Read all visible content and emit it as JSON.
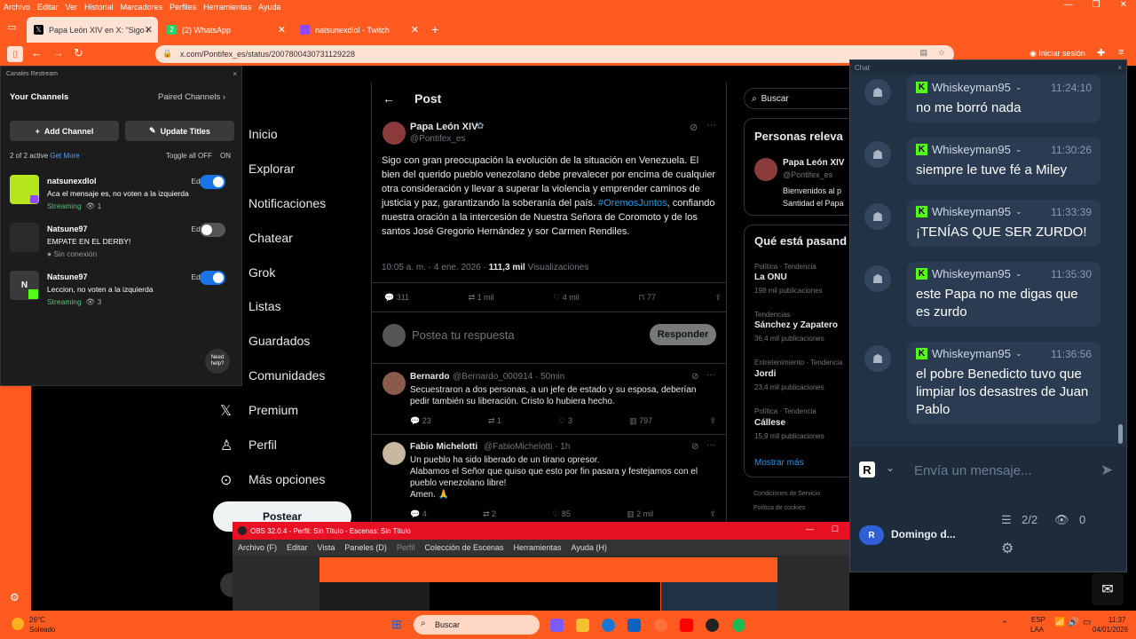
{
  "menubar": {
    "items": [
      "Archivo",
      "Editar",
      "Ver",
      "Historial",
      "Marcadores",
      "Perfiles",
      "Herramientas",
      "Ayuda"
    ]
  },
  "tabs": [
    {
      "label": "Papa León XIV en X: \"Sigo con gran",
      "icon": "x-logo",
      "active": true
    },
    {
      "label": "(2) WhatsApp",
      "badge": "2",
      "icon": "whatsapp",
      "active": false
    },
    {
      "label": "natsunexdlol - Twitch",
      "icon": "twitch",
      "active": false
    }
  ],
  "toolbar": {
    "url": "x.com/Pontifex_es/status/2007800430731129228",
    "signin": "Iniciar sesión"
  },
  "restream": {
    "title": "Canales Restream",
    "your_channels": "Your Channels",
    "paired_channels": "Paired Channels",
    "add_channel": "Add Channel",
    "update_titles": "Update Titles",
    "active_count": "2 of 2 active",
    "get_more": "Get More",
    "toggle_all": "Toggle all OFF",
    "on": "ON",
    "edit": "Edit",
    "need_help": "Need help?",
    "channels": [
      {
        "name": "natsunexdlol",
        "title": "Aca el mensaje es, no voten a la izquierda",
        "status": "Streaming",
        "viewers": "1",
        "on": true
      },
      {
        "name": "Natsune97",
        "title": "EMPATE EN EL DERBY!",
        "status": "Sin conexión",
        "viewers": "",
        "on": false
      },
      {
        "name": "Natsune97",
        "title": "Leccion, no voten a la izquierda",
        "status": "Streaming",
        "viewers": "3",
        "on": true
      }
    ]
  },
  "xnav": {
    "items": [
      "Inicio",
      "Explorar",
      "Notificaciones",
      "Chatear",
      "Grok",
      "Listas",
      "Guardados",
      "Comunidades",
      "Premium",
      "Perfil",
      "Más opciones"
    ],
    "post_button": "Postear"
  },
  "post": {
    "header": "Post",
    "author": "Papa León XIV",
    "handle": "@Pontifex_es",
    "text1": "Sigo con gran preocupación la evolución de la situación en Venezuela. El bien del querido pueblo venezolano debe prevalecer por encima de cualquier otra consideración y llevar a superar la violencia y emprender caminos de justicia y paz, garantizando la soberanía del país.",
    "hashtag": "#OremosJuntos",
    "text2": ", confiando nuestra oración a la intercesión de Nuestra Señora de Coromoto y de los santos José Gregorio Hernández y sor Carmen Rendiles.",
    "time": "10:05 a. m. · 4 ene. 2026 ·",
    "views": "111,3 mil",
    "views_label": "Visualizaciones",
    "replies": "311",
    "reposts": "1 mil",
    "likes": "4 mil",
    "bookmarks": "77",
    "reply_placeholder": "Postea tu respuesta",
    "reply_button": "Responder"
  },
  "replies": [
    {
      "name": "Bernardo",
      "handle": "@Bernardo_000914 · 50min",
      "text": "Secuestraron a dos personas, a un jefe de estado y su esposa, deberían pedir también su liberación. Cristo lo hubiera hecho.",
      "r": "23",
      "rt": "1",
      "l": "3",
      "v": "797"
    },
    {
      "name": "Fabio Michelotti",
      "handle": "@FabioMichelotti · 1h",
      "text": "Un pueblo ha sido liberado de un tirano opresor.",
      "text2": "Alabamos el Señor que quiso que esto por fin pasara y festejamos con el pueblo venezolano libre!",
      "text3": "Amen. 🙏",
      "r": "4",
      "rt": "2",
      "l": "85",
      "v": "2 mil"
    }
  ],
  "right": {
    "search": "Buscar",
    "relevant_title": "Personas releva",
    "relevant_name": "Papa León XIV",
    "relevant_handle": "@Pontifex_es",
    "relevant_bio": "Bienvenidos al p Santidad el Papa",
    "trending_title": "Qué está pasand",
    "trends": [
      {
        "cat": "Política · Tendencia",
        "name": "La ONU",
        "count": "198 mil publicaciones"
      },
      {
        "cat": "Tendencias",
        "name": "Sánchez y Zapatero",
        "count": "36,4 mil publicaciones"
      },
      {
        "cat": "Entretenimiento · Tendencia",
        "name": "Jordi",
        "count": "23,4 mil publicaciones"
      },
      {
        "cat": "Política · Tendencia",
        "name": "Cállese",
        "count": "15,9 mil publicaciones"
      }
    ],
    "show_more": "Mostrar más",
    "footer1": "Condiciones de Servicio",
    "footer2": "Política de cookies"
  },
  "chat": {
    "title": "Chat",
    "messages": [
      {
        "user": "Whiskeyman95",
        "time": "11:24:10",
        "text": "no me borró nada"
      },
      {
        "user": "Whiskeyman95",
        "time": "11:30:26",
        "text": "siempre le tuve fé a Miley"
      },
      {
        "user": "Whiskeyman95",
        "time": "11:33:39",
        "text": "¡TENÍAS QUE SER ZURDO!"
      },
      {
        "user": "Whiskeyman95",
        "time": "11:35:30",
        "text": "este Papa no me digas que es zurdo"
      },
      {
        "user": "Whiskeyman95",
        "time": "11:36:56",
        "text": "el pobre Benedicto tuvo que limpiar los desastres de Juan Pablo"
      }
    ],
    "input_placeholder": "Envía un mensaje...",
    "stream_title": "Domingo d...",
    "channels_active": "2/2",
    "viewers": "0"
  },
  "obs": {
    "title": "OBS 32.0.4 - Perfil: Sin Título - Escenas: Sin Título",
    "menu": [
      "Archivo (F)",
      "Editar",
      "Vista",
      "Paneles (D)",
      "Perfil",
      "Colección de Escenas",
      "Herramientas",
      "Ayuda (H)"
    ]
  },
  "taskbar": {
    "temp": "26°C",
    "weather": "Soleado",
    "search": "Buscar",
    "lang": "ESP",
    "lang2": "LAA",
    "time": "11:37",
    "date": "04/01/2026"
  },
  "colors": {
    "brand": "#ff5a1f",
    "x_blue": "#1d9bf0",
    "kick_green": "#53fc18",
    "toggle_on": "#1a73e8"
  }
}
